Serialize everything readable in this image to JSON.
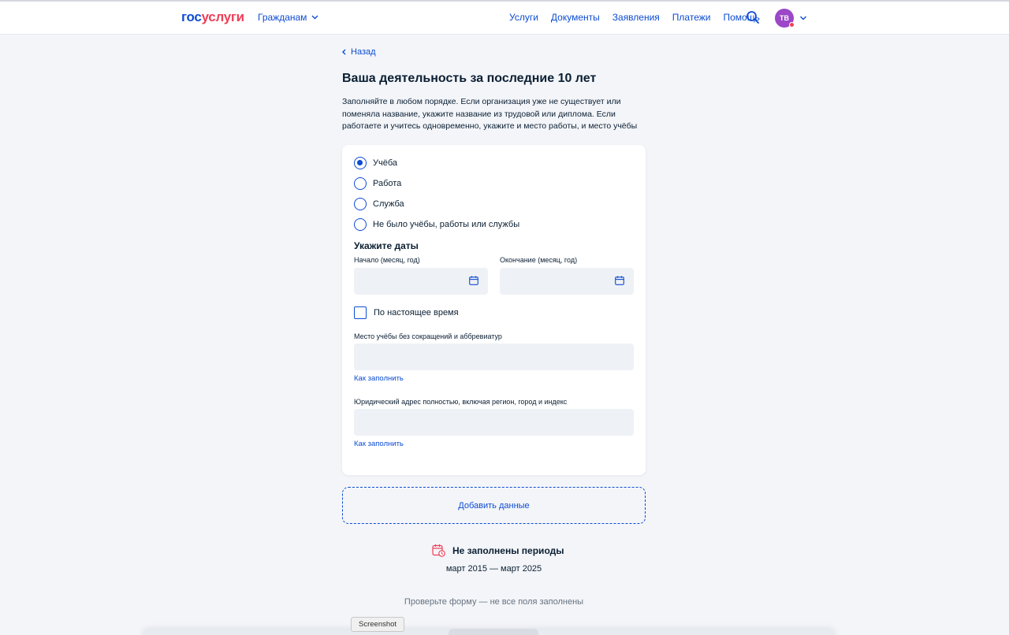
{
  "header": {
    "logo_part1": "гос",
    "logo_part2": "услуги",
    "citizens_menu": "Гражданам",
    "nav": [
      "Услуги",
      "Документы",
      "Заявления",
      "Платежи",
      "Помощь"
    ],
    "avatar_initials": "ТВ"
  },
  "page": {
    "back_label": "Назад",
    "title": "Ваша деятельность за последние 10 лет",
    "intro": "Заполняйте в любом порядке. Если организация уже не существует или поменяла название, укажите название из трудовой или диплома. Если работаете и учитесь одновременно, укажите и место работы, и место учёбы"
  },
  "form": {
    "activity_options": [
      {
        "label": "Учёба",
        "checked": true
      },
      {
        "label": "Работа",
        "checked": false
      },
      {
        "label": "Служба",
        "checked": false
      },
      {
        "label": "Не было учёбы, работы или службы",
        "checked": false
      }
    ],
    "dates_title": "Укажите даты",
    "start_label": "Начало (месяц, год)",
    "end_label": "Окончание (месяц, год)",
    "start_value": "",
    "end_value": "",
    "present_label": "По настоящее время",
    "present_checked": false,
    "place_label": "Место учёбы без сокращений и аббревиатур",
    "place_value": "",
    "address_label": "Юридический адрес полностью, включая регион, город и индекс",
    "address_value": "",
    "how_to_fill": "Как заполнить"
  },
  "add_data_label": "Добавить данные",
  "warning": {
    "title": "Не заполнены периоды",
    "period": "март 2015 — март 2025"
  },
  "check_form_text": "Проверьте форму — не все поля заполнены",
  "tooltip": "Screenshot",
  "colors": {
    "accent": "#0d4cd3",
    "brand_red": "#ee3f58",
    "avatar": "#9b47c7",
    "background": "#f3f5f9"
  }
}
